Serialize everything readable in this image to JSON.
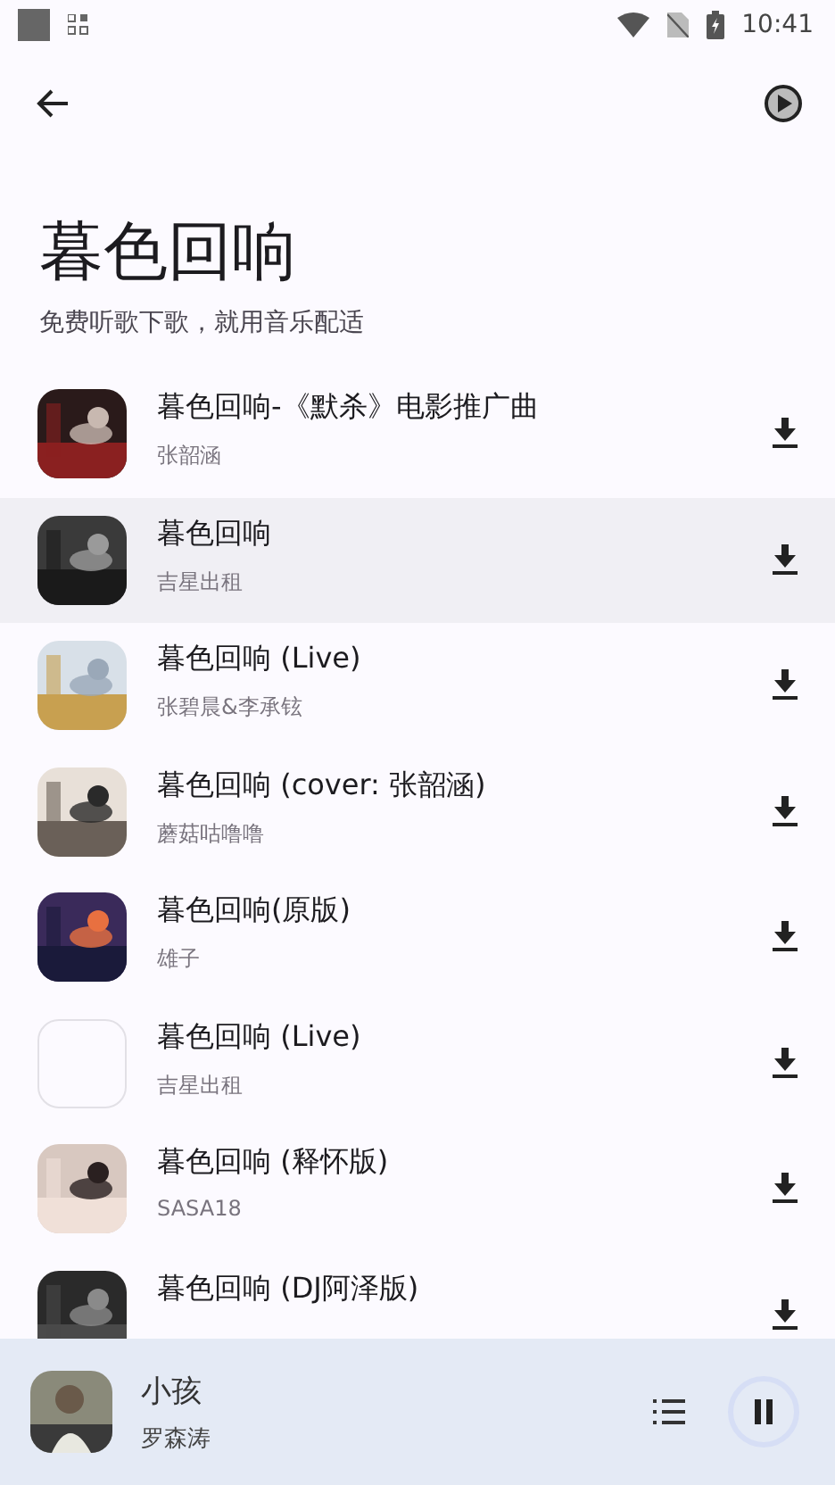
{
  "status_bar": {
    "time": "10:41"
  },
  "header": {
    "title": "暮色回响",
    "subtitle": "免费听歌下歌，就用音乐配适"
  },
  "songs": [
    {
      "title": "暮色回响-《默杀》电影推广曲",
      "artist": "张韶涵",
      "kind": "picture",
      "selected": false
    },
    {
      "title": "暮色回响",
      "artist": "吉星出租",
      "kind": "picture",
      "selected": true
    },
    {
      "title": "暮色回响 (Live)",
      "artist": "张碧晨&李承铉",
      "kind": "picture",
      "selected": false
    },
    {
      "title": "暮色回响 (cover: 张韶涵)",
      "artist": "蘑菇咕噜噜",
      "kind": "picture",
      "selected": false
    },
    {
      "title": "暮色回响(原版)",
      "artist": "雄子",
      "kind": "picture",
      "selected": false
    },
    {
      "title": "暮色回响 (Live)",
      "artist": "吉星出租",
      "kind": "empty",
      "selected": false
    },
    {
      "title": "暮色回响 (释怀版)",
      "artist": "SASA18",
      "kind": "picture",
      "selected": false
    },
    {
      "title": "暮色回响 (DJ阿泽版)",
      "kind": "picture",
      "selected": false
    }
  ],
  "player": {
    "title": "小孩",
    "artist": "罗森涛"
  }
}
